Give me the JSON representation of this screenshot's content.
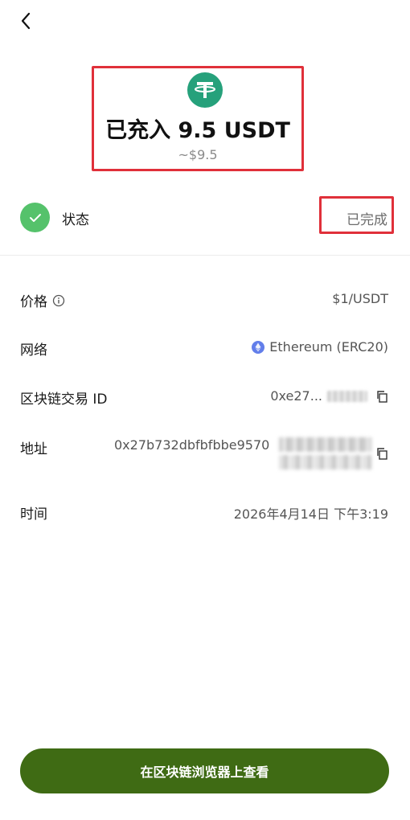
{
  "header": {
    "back_icon": "chevron-left-icon"
  },
  "hero": {
    "coin_icon": "tether-usdt-icon",
    "coin_color": "#26a17b",
    "title": "已充入 9.5 USDT",
    "fiat_value": "~$9.5"
  },
  "status": {
    "label": "状态",
    "value": "已完成",
    "icon": "check-icon",
    "icon_color": "#55c26b"
  },
  "details": {
    "price": {
      "label": "价格",
      "value": "$1/USDT"
    },
    "network": {
      "label": "网络",
      "value": "Ethereum (ERC20)",
      "icon_color": "#627eea"
    },
    "tx_id": {
      "label": "区块链交易 ID",
      "value_prefix": "0xe27..."
    },
    "address": {
      "label": "地址",
      "value_prefix": "0x27b732dbfbfbbe9570"
    },
    "time": {
      "label": "时间",
      "value": "2026年4月14日 下午3:19"
    }
  },
  "cta": {
    "label": "在区块链浏览器上查看",
    "color": "#3f6b14"
  },
  "highlight_color": "#e0303a"
}
